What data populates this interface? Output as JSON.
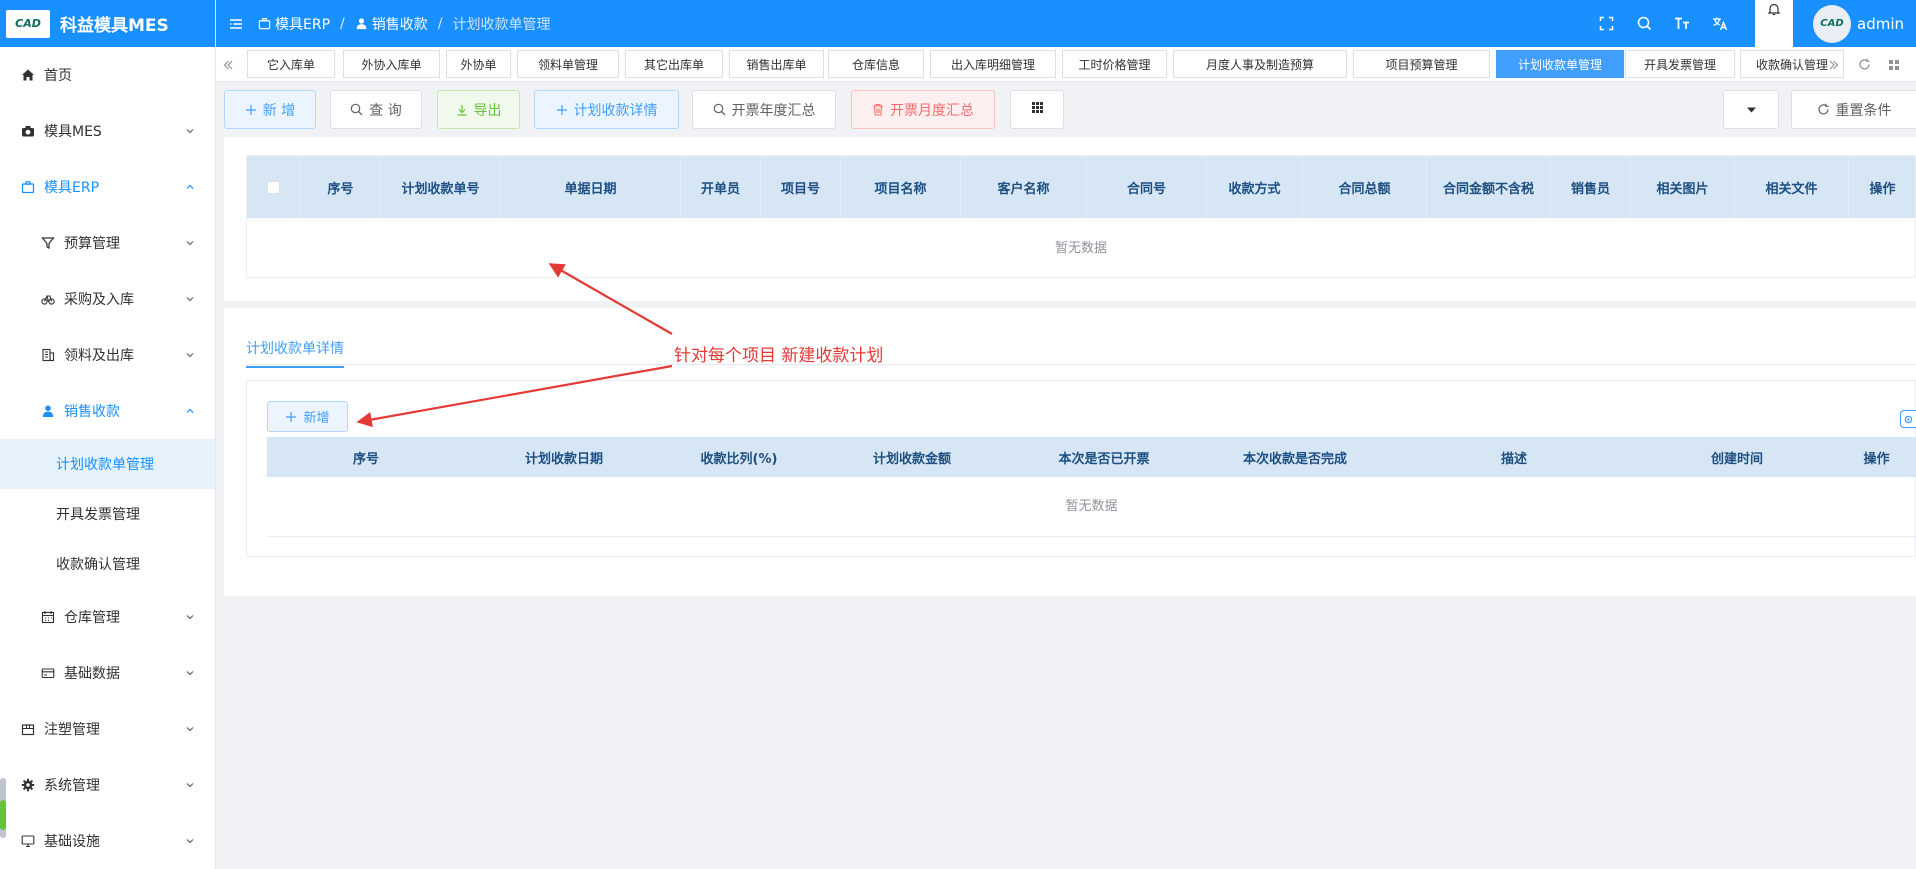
{
  "app": {
    "title": "科益模具MES",
    "logo_text": "CAD"
  },
  "sidebar": {
    "items": [
      {
        "label": "首页",
        "icon": "home-icon"
      },
      {
        "label": "模具MES",
        "icon": "camera-icon"
      },
      {
        "label": "模具ERP",
        "icon": "briefcase-icon"
      },
      {
        "label": "预算管理",
        "icon": "filter-icon"
      },
      {
        "label": "采购及入库",
        "icon": "bike-icon"
      },
      {
        "label": "领料及出库",
        "icon": "building-icon"
      },
      {
        "label": "销售收款",
        "icon": "user-icon"
      },
      {
        "label": "计划收款单管理"
      },
      {
        "label": "开具发票管理"
      },
      {
        "label": "收款确认管理"
      },
      {
        "label": "仓库管理",
        "icon": "calendar-icon"
      },
      {
        "label": "基础数据",
        "icon": "card-icon"
      },
      {
        "label": "注塑管理",
        "icon": "box-icon"
      },
      {
        "label": "系统管理",
        "icon": "gear-icon"
      },
      {
        "label": "基础设施",
        "icon": "monitor-icon"
      }
    ]
  },
  "header": {
    "breadcrumb": [
      "模具ERP",
      "销售收款",
      "计划收款单管理"
    ],
    "user": "admin"
  },
  "tabs": [
    "它入库单",
    "外协入库单",
    "外协单",
    "领料单管理",
    "其它出库单",
    "销售出库单",
    "仓库信息",
    "出入库明细管理",
    "工时价格管理",
    "月度人事及制造预算",
    "项目预算管理",
    "计划收款单管理",
    "开具发票管理",
    "收款确认管理"
  ],
  "active_tab": "计划收款单管理",
  "toolbar": {
    "add": "新 增",
    "query": "查 询",
    "export": "导出",
    "plan_detail": "计划收款详情",
    "invoice_year": "开票年度汇总",
    "invoice_month": "开票月度汇总",
    "reset": "重置条件"
  },
  "main_table": {
    "columns": [
      "序号",
      "计划收款单号",
      "单据日期",
      "开单员",
      "项目号",
      "项目名称",
      "客户名称",
      "合同号",
      "收款方式",
      "合同总额",
      "合同金额不含税",
      "销售员",
      "相关图片",
      "相关文件",
      "操作"
    ],
    "empty_text": "暂无数据"
  },
  "detail": {
    "tab_label": "计划收款单详情",
    "add_label": "新增",
    "columns": [
      "序号",
      "计划收款日期",
      "收款比列(%)",
      "计划收款金额",
      "本次是否已开票",
      "本次收款是否完成",
      "描述",
      "创建时间",
      "操作"
    ],
    "empty_text": "暂无数据"
  },
  "annotation": {
    "text": "针对每个项目 新建收款计划",
    "color": "#e53935"
  },
  "colors": {
    "primary": "#1890ff",
    "table_header": "#d6e6f5"
  }
}
